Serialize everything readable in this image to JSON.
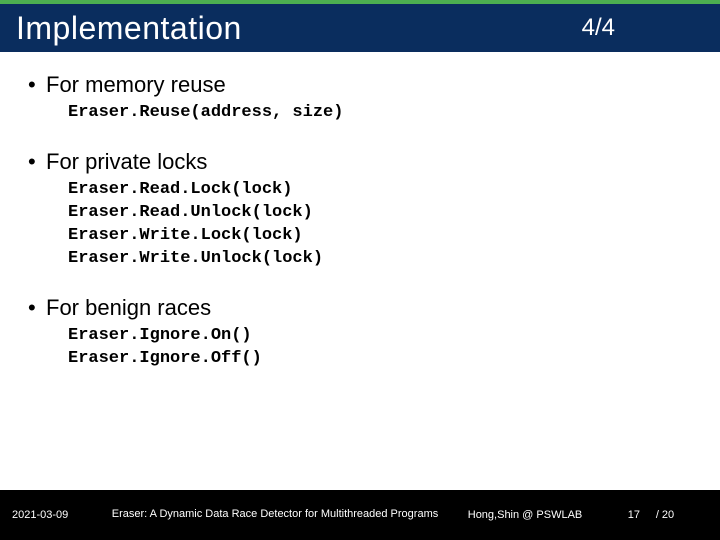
{
  "header": {
    "title": "Implementation",
    "page_indicator": "4/4"
  },
  "sections": [
    {
      "heading": "For memory reuse",
      "code": [
        "Eraser.Reuse(address, size)"
      ]
    },
    {
      "heading": "For private locks",
      "code": [
        "Eraser.Read.Lock(lock)",
        "Eraser.Read.Unlock(lock)",
        "Eraser.Write.Lock(lock)",
        "Eraser.Write.Unlock(lock)"
      ]
    },
    {
      "heading": "For benign races",
      "code": [
        "Eraser.Ignore.On()",
        "Eraser.Ignore.Off()"
      ]
    }
  ],
  "footer": {
    "date": "2021-03-09",
    "title": "Eraser: A Dynamic Data Race Detector for Multithreaded Programs",
    "author": "Hong,Shin @ PSWLAB",
    "page_num": "17",
    "total_pages": "/ 20"
  }
}
